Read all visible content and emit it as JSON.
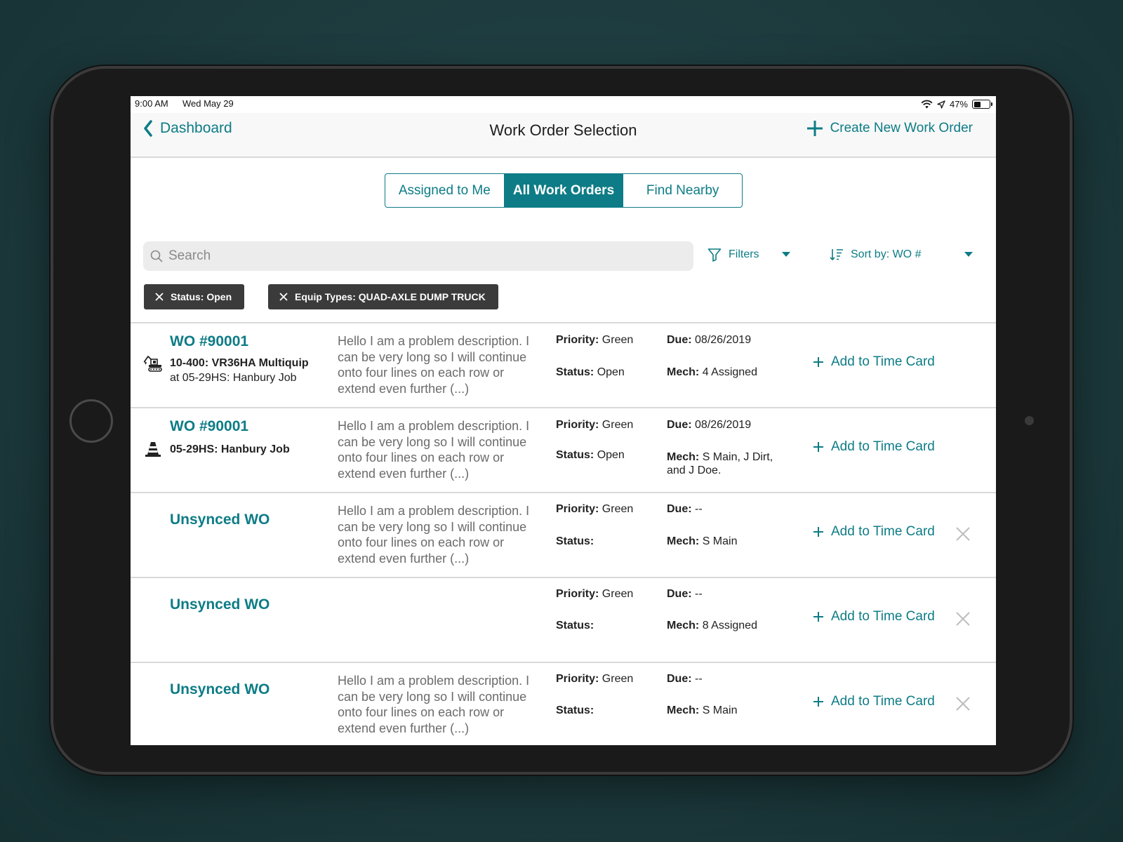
{
  "status_bar": {
    "time": "9:00 AM",
    "date": "Wed May 29",
    "battery": "47%",
    "battery_level": 0.47
  },
  "nav": {
    "back_label": "Dashboard",
    "title": "Work Order Selection",
    "create_label": "Create New Work Order"
  },
  "tabs": [
    {
      "label": "Assigned to Me",
      "active": false
    },
    {
      "label": "All Work Orders",
      "active": true
    },
    {
      "label": "Find Nearby",
      "active": false
    }
  ],
  "search": {
    "placeholder": "Search",
    "value": ""
  },
  "filters_label": "Filters",
  "sort_label": "Sort by: WO #",
  "chips": [
    "Status: Open",
    "Equip Types: QUAD-AXLE DUMP TRUCK"
  ],
  "labels": {
    "priority": "Priority:",
    "status": "Status:",
    "due": "Due:",
    "mech": "Mech:",
    "add_time_card": "Add to Time Card"
  },
  "work_orders": [
    {
      "title": "WO #90001",
      "icon": "excavator-icon",
      "sub_bold": "10-400: VR36HA Multiquip",
      "sub_line": "at 05-29HS: Hanbury Job",
      "description": "Hello I am a problem description. I can be very long so I will continue onto four lines on each row or extend even further (...)",
      "priority": "Green",
      "status": "Open",
      "due": "08/26/2019",
      "mech": " 4 Assigned",
      "removable": false
    },
    {
      "title": "WO #90001",
      "icon": "traffic-cone-icon",
      "sub_bold": "05-29HS: Hanbury Job",
      "sub_line": "",
      "description": "Hello I am a problem description. I can be very long so I will continue onto four lines on each row or extend even further (...)",
      "priority": "Green",
      "status": "Open",
      "due": "08/26/2019",
      "mech": "S Main, J Dirt, and J Doe.",
      "removable": false
    },
    {
      "title": "Unsynced WO",
      "description": "Hello I am a problem description. I can be very long so I will continue onto four lines on each row or extend even further (...)",
      "priority": "Green",
      "status": "",
      "due": "--",
      "mech": "S Main",
      "removable": true
    },
    {
      "title": "Unsynced WO",
      "description": "",
      "priority": "Green",
      "status": "",
      "due": "--",
      "mech": "8 Assigned",
      "removable": true
    },
    {
      "title": "Unsynced WO",
      "description": "Hello I am a problem description. I can be very long so I will continue onto four lines on each row or extend even further (...)",
      "priority": "Green",
      "status": "",
      "due": "--",
      "mech": "S Main",
      "removable": true
    }
  ],
  "colors": {
    "accent": "#0d7c86",
    "chip": "#3b3b3b",
    "divider": "#d9d9d9"
  }
}
